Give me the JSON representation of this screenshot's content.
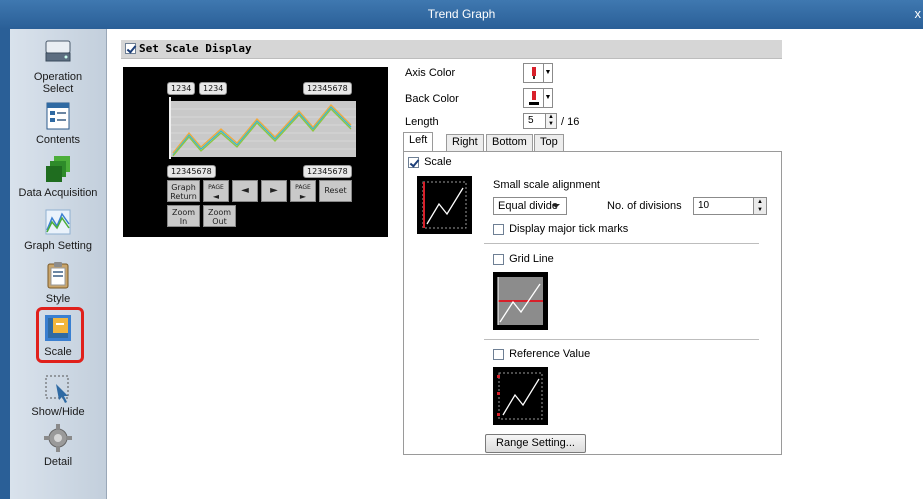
{
  "window": {
    "title": "Trend Graph",
    "close_label": "x"
  },
  "sidebar": {
    "items": [
      {
        "label_line1": "Operation",
        "label_line2": "Select",
        "icon": "operation-select-icon"
      },
      {
        "label": "Contents",
        "icon": "contents-icon"
      },
      {
        "label": "Data Acquisition",
        "icon": "data-acquisition-icon"
      },
      {
        "label": "Graph Setting",
        "icon": "graph-setting-icon"
      },
      {
        "label": "Style",
        "icon": "style-icon"
      },
      {
        "label": "Scale",
        "icon": "scale-icon",
        "selected": true
      },
      {
        "label": "Show/Hide",
        "icon": "show-hide-icon"
      },
      {
        "label": "Detail",
        "icon": "gear-icon"
      }
    ]
  },
  "header": {
    "set_scale_display_label": "Set Scale Display",
    "checked": true
  },
  "preview": {
    "labels": {
      "top_left_1": "1234",
      "top_left_2": "1234",
      "top_right": "12345678",
      "bottom_left": "12345678",
      "bottom_right": "12345678"
    },
    "buttons": {
      "graph_return_line1": "Graph",
      "graph_return_line2": "Return",
      "page_left_top": "PAGE",
      "page_left_arrow": "◄",
      "left_arrow": "◄",
      "right_arrow": "►",
      "page_right_top": "PAGE",
      "page_right_arrow": "►",
      "reset": "Reset",
      "zoom_in_line1": "Zoom",
      "zoom_in_line2": "In",
      "zoom_out_line1": "Zoom",
      "zoom_out_line2": "Out"
    }
  },
  "props": {
    "axis_color_label": "Axis Color",
    "back_color_label": "Back Color",
    "length_label": "Length",
    "length_value": "5",
    "length_max": "/ 16"
  },
  "tabs": [
    {
      "label": "Left",
      "active": true
    },
    {
      "label": "Right"
    },
    {
      "label": "Bottom"
    },
    {
      "label": "Top"
    }
  ],
  "scale_section": {
    "scale_label": "Scale",
    "scale_checked": true,
    "small_scale_alignment_label": "Small scale alignment",
    "alignment_value": "Equal divide",
    "divisions_label": "No. of divisions",
    "divisions_value": "10",
    "major_tick_label": "Display major tick marks",
    "grid_line_label": "Grid Line",
    "reference_value_label": "Reference Value",
    "range_setting_label": "Range Setting..."
  },
  "colors": {
    "title_bar": "#2f6aa3",
    "highlight": "#e0201b",
    "accent_red": "#d8202a"
  }
}
